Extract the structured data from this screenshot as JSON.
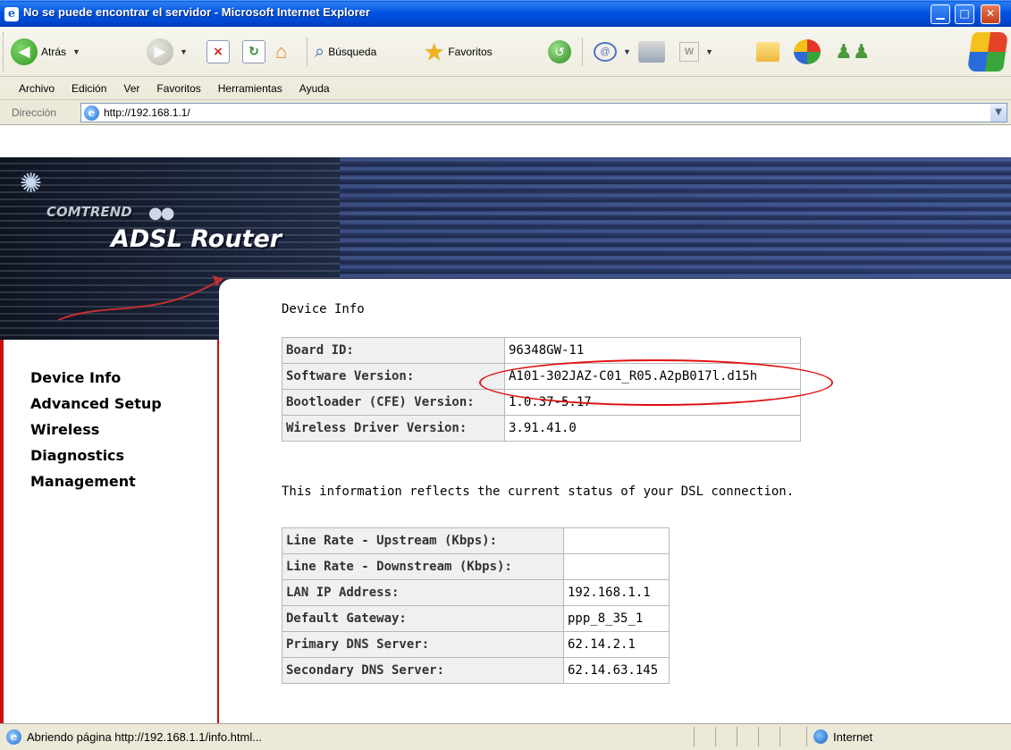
{
  "window": {
    "title": "No se puede encontrar el servidor - Microsoft Internet Explorer",
    "minimize": "▁",
    "maximize": "□",
    "close": "✕"
  },
  "toolbar": {
    "back_label": "Atrás",
    "search_label": "Búsqueda",
    "favorites_label": "Favoritos",
    "stop_icon": "×",
    "refresh_icon": "↻",
    "home_icon": "⌂",
    "history_icon": "↺",
    "word_icon": "W"
  },
  "menu": [
    "Archivo",
    "Edición",
    "Ver",
    "Favoritos",
    "Herramientas",
    "Ayuda"
  ],
  "address": {
    "label": "Dirección",
    "url": "http://192.168.1.1/"
  },
  "banner": {
    "brand": "COMTREND",
    "product": "ADSL Router"
  },
  "nav": [
    "Device Info",
    "Advanced Setup",
    "Wireless",
    "Diagnostics",
    "Management"
  ],
  "page": {
    "title": "Device Info",
    "info_text": "This information reflects the current status of your DSL connection."
  },
  "device_table": [
    {
      "key": "Board ID:",
      "value": "96348GW-11"
    },
    {
      "key": "Software Version:",
      "value": "A101-302JAZ-C01_R05.A2pB017l.d15h"
    },
    {
      "key": "Bootloader (CFE) Version:",
      "value": "1.0.37-5.17"
    },
    {
      "key": "Wireless Driver Version:",
      "value": "3.91.41.0"
    }
  ],
  "status_table": [
    {
      "key": "Line Rate - Upstream (Kbps):",
      "value": ""
    },
    {
      "key": "Line Rate - Downstream (Kbps):",
      "value": ""
    },
    {
      "key": "LAN IP Address:",
      "value": "192.168.1.1"
    },
    {
      "key": "Default Gateway:",
      "value": "ppp_8_35_1"
    },
    {
      "key": "Primary DNS Server:",
      "value": "62.14.2.1"
    },
    {
      "key": "Secondary DNS Server:",
      "value": "62.14.63.145"
    }
  ],
  "statusbar": {
    "message": "Abriendo página http://192.168.1.1/info.html...",
    "zone": "Internet"
  },
  "colors": {
    "titlebar": "#0054e3",
    "highlight_ellipse": "#e01010",
    "sidebar_border": "#c81010"
  }
}
